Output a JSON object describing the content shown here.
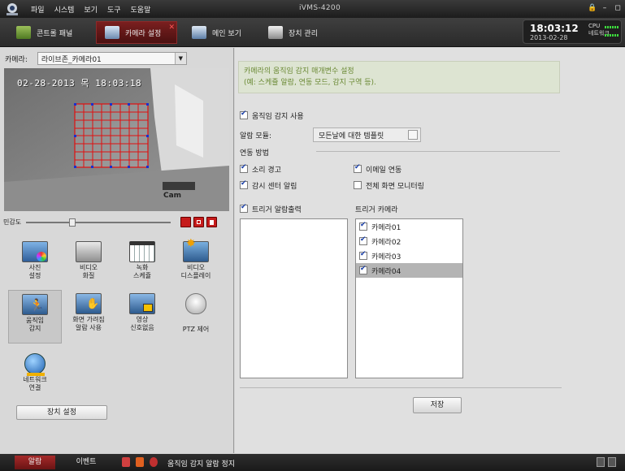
{
  "window": {
    "title": "iVMS-4200",
    "menu": [
      "파일",
      "시스템",
      "보기",
      "도구",
      "도움말"
    ],
    "controls": [
      "lock-icon",
      "minimize-icon",
      "restore-icon"
    ]
  },
  "toolbar": {
    "tabs": [
      {
        "label": "콘트롤 패널",
        "icon": "control-panel-icon"
      },
      {
        "label": "카메라 설정",
        "icon": "camera-settings-icon",
        "active": true
      },
      {
        "label": "메인 보기",
        "icon": "monitor-icon"
      },
      {
        "label": "장치 관리",
        "icon": "device-management-icon"
      }
    ],
    "clock": {
      "time": "18:03:12",
      "date": "2013-02-28"
    },
    "cpu_label": "CPU",
    "network_label": "네트워크"
  },
  "left": {
    "camera_label": "카메라:",
    "camera_value": "라이브존_카메라01",
    "video": {
      "timestamp": "02-28-2013 목 18:03:18",
      "label": "Cam"
    },
    "sensitivity_label": "민감도",
    "sensitivity_level": 0.32,
    "tiles": [
      {
        "label": "사진\n설정",
        "icon": "photo-settings-icon"
      },
      {
        "label": "비디오\n화질",
        "icon": "video-quality-icon"
      },
      {
        "label": "녹화\n스케쥴",
        "icon": "record-schedule-icon"
      },
      {
        "label": "비디오\n디스플레이",
        "icon": "video-display-icon"
      },
      {
        "label": "움직임\n감지",
        "icon": "motion-detection-icon",
        "selected": true
      },
      {
        "label": "화면 가려짐\n알람 사용",
        "icon": "tamper-alarm-icon"
      },
      {
        "label": "영상\n신호없음",
        "icon": "video-loss-icon"
      },
      {
        "label": "PTZ 제어",
        "icon": "ptz-camera-icon"
      },
      {
        "label": "네트워크\n연결",
        "icon": "network-connection-icon"
      }
    ],
    "device_settings_label": "장치 설정"
  },
  "right": {
    "info_line1": "카메라의 움직임 감지 매개변수 설정",
    "info_line2": "(예: 스케쥴 알람, 연동 모드, 감지 구역 등).",
    "enable_motion_label": "움직임 감지 사용",
    "enable_motion_checked": true,
    "alarm_template_label": "알람 모듈:",
    "alarm_template_value": "모든날에 대한 템플릿",
    "linkage_label": "연동 방법",
    "linkage": [
      {
        "label": "소리 경고",
        "checked": true
      },
      {
        "label": "이메일 연동",
        "checked": true
      },
      {
        "label": "감시 센터 알림",
        "checked": true
      },
      {
        "label": "전체 화면 모니터링",
        "checked": false
      }
    ],
    "trigger_output_label": "트리거 알람출력",
    "trigger_output_checked": true,
    "trigger_camera_label": "트리거 카메라",
    "trigger_cameras": [
      {
        "label": "카메라01",
        "checked": true
      },
      {
        "label": "카메라02",
        "checked": true
      },
      {
        "label": "카메라03",
        "checked": true
      },
      {
        "label": "카메라04",
        "checked": true,
        "selected": true
      }
    ],
    "save_label": "저장"
  },
  "statusbar": {
    "tabs": [
      "알람",
      "이벤트"
    ],
    "message": "움직임 감지 알람 정지"
  },
  "colors": {
    "accent": "#8a1f1f",
    "info_text": "#6b8a35",
    "grid": "#e01010"
  }
}
